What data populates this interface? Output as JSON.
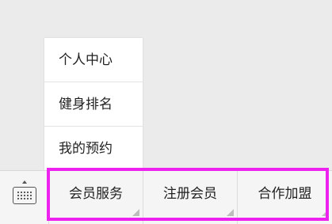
{
  "submenu": {
    "items": [
      {
        "label": "个人中心"
      },
      {
        "label": "健身排名"
      },
      {
        "label": "我的预约"
      }
    ]
  },
  "menubar": {
    "keyboard_icon": "keyboard-icon",
    "buttons": [
      {
        "label": "会员服务"
      },
      {
        "label": "注册会员"
      },
      {
        "label": "合作加盟"
      }
    ]
  },
  "highlight": {
    "color": "#ee22ee"
  }
}
